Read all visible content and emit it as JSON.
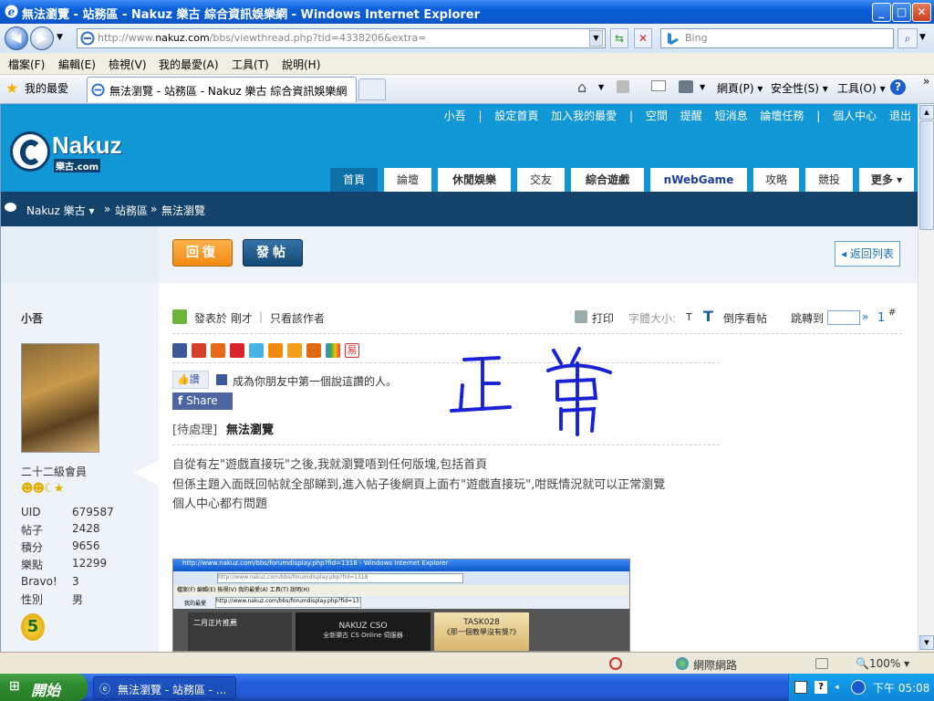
{
  "window": {
    "title": "無法瀏覽 - 站務區 - Nakuz 樂古 綜合資訊娛樂網 - Windows Internet Explorer",
    "min": "_",
    "max": "□",
    "close": "✕"
  },
  "address": {
    "url_prefix": "http://www.",
    "url_domain": "nakuz.com",
    "url_rest": "/bbs/viewthread.php?tid=4338206&extra=",
    "search_placeholder": "Bing"
  },
  "menu": [
    "檔案(F)",
    "編輯(E)",
    "檢視(V)",
    "我的最愛(A)",
    "工具(T)",
    "說明(H)"
  ],
  "favbar": {
    "favorites": "我的最愛",
    "tab_title": "無法瀏覽 - 站務區 - Nakuz 樂古 綜合資訊娛樂網",
    "page_menu": "網頁(P)",
    "safety_menu": "安全性(S)",
    "tools_menu": "工具(O)",
    "more": "»"
  },
  "site": {
    "toplinks": [
      "小吾",
      "|",
      "設定首頁",
      "加入我的最愛",
      "|",
      "空間",
      "提醒",
      "短消息",
      "論壇任務",
      "|",
      "個人中心",
      "退出"
    ],
    "logo_text": "Nakuz",
    "logo_sub": "樂古.com",
    "nav": [
      "首頁",
      "論壇",
      "休閒娛樂",
      "交友",
      "綜合遊戲",
      "nWebGame",
      "攻略",
      "競投",
      "更多"
    ],
    "breadcrumb": {
      "home": "Nakuz 樂古",
      "sep": "»",
      "section": "站務區",
      "current": "無法瀏覽"
    }
  },
  "actions": {
    "reply": "回復",
    "post": "發帖",
    "back": "返回列表"
  },
  "user": {
    "name": "小吾",
    "rank": "二十二級會員",
    "stats": [
      {
        "label": "UID",
        "value": "679587"
      },
      {
        "label": "帖子",
        "value": "2428"
      },
      {
        "label": "積分",
        "value": "9656"
      },
      {
        "label": "樂點",
        "value": "12299"
      },
      {
        "label": "Bravo!",
        "value": "3"
      },
      {
        "label": "性別",
        "value": "男"
      }
    ]
  },
  "post": {
    "posted_at": "發表於 剛才",
    "only_author": "只看該作者",
    "print": "打印",
    "font_size_label": "字體大小:",
    "font_t": "T",
    "reverse": "倒序看帖",
    "jump_to": "跳轉到",
    "jump_go": "»",
    "floor": "1",
    "floor_mark": "#",
    "like": "讚",
    "like_text": "成為你朋友中第一個說這讚的人。",
    "share": "Share",
    "tag": "[待處理]",
    "title": "無法瀏覽",
    "body": [
      "自從有左\"遊戲直接玩\"之後,我就瀏覽唔到任何版塊,包括首頁",
      "但係主題入面既回帖就全部睇到,進入帖子後網頁上面冇\"遊戲直接玩\",咁既情況就可以正常瀏覽",
      "個人中心都冇問題"
    ],
    "handwriting": "正常",
    "screenshot": {
      "title": "http://www.nakuz.com/bbs/forumdisplay.php?fid=1318 - Windows Internet Explorer",
      "url": "http://www.nakuz.com/bbs/forumdisplay.php?fid=1318",
      "menu": "檔案(F)  編輯(E)  檢視(V)  我的最愛(A)  工具(T)  說明(H)",
      "tab": "http://www.nakuz.com/bbs/forumdisplay.php?fid=1318",
      "favorites": "我的最愛",
      "banner1": "二月正片推薦",
      "banner2": "NAKUZ CSO",
      "banner2_sub": "全新樂古 CS Online 伺服器",
      "banner3": "TASK028",
      "banner3_sub": "《那一個教學沒有獎?》"
    }
  },
  "status": {
    "zone": "網際網路",
    "zoom": "100%"
  },
  "taskbar": {
    "start": "開始",
    "task": "無法瀏覽 - 站務區 - ...",
    "clock": "下午 05:08"
  }
}
